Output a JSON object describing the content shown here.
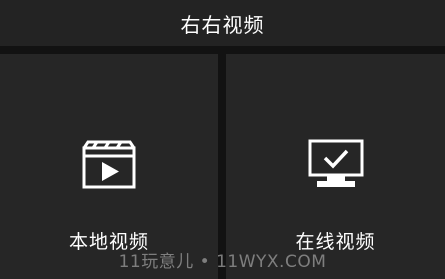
{
  "header": {
    "title": "右右视频"
  },
  "tiles": [
    {
      "label": "本地视频",
      "icon": "clapperboard-play-icon"
    },
    {
      "label": "在线视频",
      "icon": "monitor-check-icon"
    }
  ],
  "watermark": "11玩意儿 • 11WYX.COM",
  "colors": {
    "background": "#121212",
    "header": "#232323",
    "tile": "#262626",
    "text": "#ffffff"
  }
}
